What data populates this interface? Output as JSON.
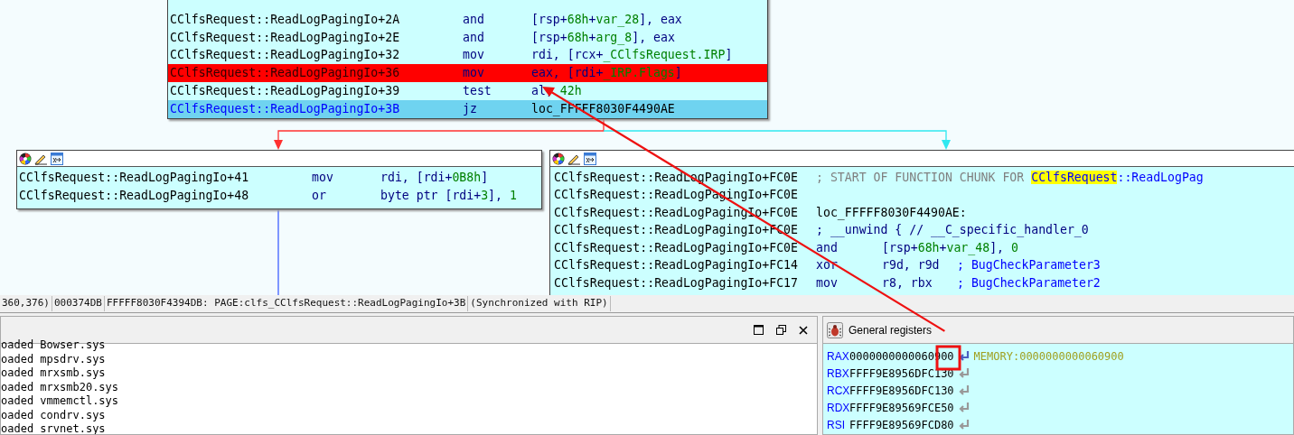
{
  "graph": {
    "top_node": {
      "rows": [
        {
          "address": "CClfsRequest::ReadLogPagingIo+2A",
          "mnemonic": "and",
          "operands": [
            {
              "kind": "reg",
              "text": "[rsp+"
            },
            {
              "kind": "num",
              "text": "68h"
            },
            {
              "kind": "reg",
              "text": "+"
            },
            {
              "kind": "name",
              "text": "var_28"
            },
            {
              "kind": "reg",
              "text": "], eax"
            }
          ]
        },
        {
          "address": "CClfsRequest::ReadLogPagingIo+2E",
          "mnemonic": "and",
          "operands": [
            {
              "kind": "reg",
              "text": "[rsp+"
            },
            {
              "kind": "num",
              "text": "68h"
            },
            {
              "kind": "reg",
              "text": "+"
            },
            {
              "kind": "name",
              "text": "arg_8"
            },
            {
              "kind": "reg",
              "text": "], eax"
            }
          ]
        },
        {
          "address": "CClfsRequest::ReadLogPagingIo+32",
          "mnemonic": "mov",
          "operands": [
            {
              "kind": "reg",
              "text": "rdi, [rcx+"
            },
            {
              "kind": "name",
              "text": "_CClfsRequest.IRP"
            },
            {
              "kind": "reg",
              "text": "]"
            }
          ]
        },
        {
          "kind": "breakpoint",
          "address": "CClfsRequest::ReadLogPagingIo+36",
          "mnemonic": "mov",
          "operands": [
            {
              "kind": "reg",
              "text": "eax, [rdi+"
            },
            {
              "kind": "name",
              "text": "_IRP.Flags"
            },
            {
              "kind": "reg",
              "text": "]"
            }
          ]
        },
        {
          "address": "CClfsRequest::ReadLogPagingIo+39",
          "mnemonic": "test",
          "operands": [
            {
              "kind": "reg",
              "text": "al, "
            },
            {
              "kind": "num",
              "text": "42h"
            }
          ]
        },
        {
          "kind": "current",
          "address": "CClfsRequest::ReadLogPagingIo+3B",
          "mnemonic": "jz",
          "operands": [
            {
              "kind": "plain",
              "text": "loc_FFFFF8030F4490AE"
            }
          ]
        }
      ]
    },
    "left_node": {
      "rows": [
        {
          "address": "CClfsRequest::ReadLogPagingIo+41",
          "mnemonic": "mov",
          "operands": [
            {
              "kind": "reg",
              "text": "rdi, [rdi+"
            },
            {
              "kind": "num",
              "text": "0B8h"
            },
            {
              "kind": "reg",
              "text": "]"
            }
          ]
        },
        {
          "address": "CClfsRequest::ReadLogPagingIo+48",
          "mnemonic": "or",
          "operands": [
            {
              "kind": "reg",
              "text": "byte ptr [rdi+"
            },
            {
              "kind": "num",
              "text": "3"
            },
            {
              "kind": "reg",
              "text": "], "
            },
            {
              "kind": "num",
              "text": "1"
            }
          ]
        }
      ]
    },
    "right_node": {
      "rows": [
        {
          "kind": "text",
          "address": "CClfsRequest::ReadLogPagingIo+FC0E",
          "segments": [
            {
              "kind": "comment",
              "text": "; START OF FUNCTION CHUNK FOR "
            },
            {
              "kind": "highlight",
              "text": "CClfsRequest"
            },
            {
              "kind": "link",
              "text": "::ReadLogPag"
            }
          ]
        },
        {
          "kind": "text",
          "address": "CClfsRequest::ReadLogPagingIo+FC0E"
        },
        {
          "kind": "text",
          "address": "CClfsRequest::ReadLogPagingIo+FC0E",
          "segments": [
            {
              "kind": "plain",
              "text": "loc_FFFFF8030F4490AE:"
            }
          ]
        },
        {
          "kind": "text",
          "address": "CClfsRequest::ReadLogPagingIo+FC0E",
          "segments": [
            {
              "kind": "reg",
              "text": "; __unwind { // __C_specific_handler_0"
            }
          ]
        },
        {
          "kind": "instruction",
          "address": "CClfsRequest::ReadLogPagingIo+FC0E",
          "mnemonic": "and",
          "operands": [
            {
              "kind": "reg",
              "text": "[rsp+"
            },
            {
              "kind": "num",
              "text": "68h"
            },
            {
              "kind": "reg",
              "text": "+"
            },
            {
              "kind": "name",
              "text": "var_48"
            },
            {
              "kind": "reg",
              "text": "], "
            },
            {
              "kind": "num",
              "text": "0"
            }
          ]
        },
        {
          "kind": "instruction",
          "address": "CClfsRequest::ReadLogPagingIo+FC14",
          "mnemonic": "xor",
          "operands": [
            {
              "kind": "reg",
              "text": "r9d, r9d"
            }
          ],
          "comment": "; BugCheckParameter3"
        },
        {
          "kind": "instruction",
          "address": "CClfsRequest::ReadLogPagingIo+FC17",
          "mnemonic": "mov",
          "operands": [
            {
              "kind": "reg",
              "text": "r8, rbx"
            }
          ],
          "comment": "; BugCheckParameter2"
        }
      ]
    }
  },
  "status_bar": [
    "360,376)",
    "000374DB",
    "FFFFF8030F4394DB: PAGE:clfs_CClfsRequest::ReadLogPagingIo+3B",
    "(Synchronized with RIP)"
  ],
  "output_panel": {
    "lines": [
      "oaded Bowser.sys",
      "oaded mpsdrv.sys",
      "oaded mrxsmb.sys",
      "oaded mrxsmb20.sys",
      "oaded vmmemctl.sys",
      "oaded condrv.sys",
      "oaded srvnet.sys"
    ]
  },
  "registers_panel": {
    "title": "General registers",
    "registers": [
      {
        "name": "RAX",
        "value": "0000000000060900",
        "highlighted": true,
        "comment": "MEMORY:0000000000060900"
      },
      {
        "name": "RBX",
        "value": "FFFF9E8956DFC130",
        "highlighted": false
      },
      {
        "name": "RCX",
        "value": "FFFF9E8956DFC130",
        "highlighted": false
      },
      {
        "name": "RDX",
        "value": "FFFF9E89569FCE50",
        "highlighted": false
      },
      {
        "name": "RSI",
        "value": "FFFF9E89569FCD80",
        "highlighted": false
      }
    ]
  }
}
